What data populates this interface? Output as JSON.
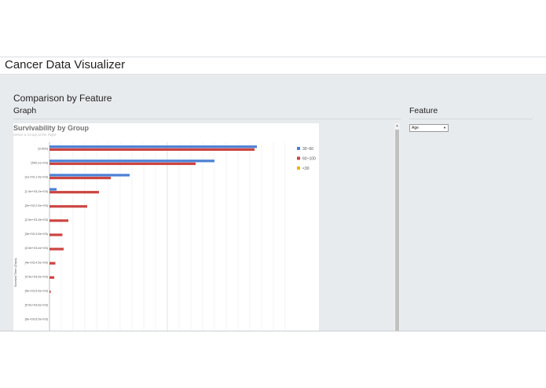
{
  "app": {
    "title": "Cancer Data Visualizer"
  },
  "page": {
    "section_title": "Comparison by Feature",
    "graph_title": "Graph",
    "feature_title": "Feature"
  },
  "feature_select": {
    "value": "Age"
  },
  "chart": {
    "title": "Survivability by Group",
    "subtitle": "Select a Group at the Right"
  },
  "colors": {
    "series1": "#4a7fd4",
    "series2": "#cc4440",
    "series3": "#f2b400"
  },
  "chart_data": {
    "type": "bar",
    "orientation": "horizontal",
    "title": "Survivability by Group",
    "subtitle": "Select a Group at the Right",
    "ylabel": "Survival Time (Days)",
    "xlabel": "",
    "legend_position": "right",
    "categories": [
      "[0,500)",
      "[500,1e+03)",
      "[1e+03,1.5e+03)",
      "[1.5e+03,2e+03)",
      "[2e+03,2.5e+03)",
      "[2.5e+03,3e+03)",
      "[3e+03,3.5e+03)",
      "[3.5e+03,4e+03)",
      "[4e+03,4.5e+03)",
      "[4.5e+03,5e+03)",
      "[5e+03,5.5e+03)",
      "[5.5e+03,6e+03)",
      "[6e+03,6.5e+03)"
    ],
    "series": [
      {
        "name": "30~60",
        "color": "#4a7fd4",
        "values": [
          88,
          70,
          34,
          3,
          0,
          0,
          0,
          0,
          0,
          0,
          0,
          0,
          0
        ]
      },
      {
        "name": "60~100",
        "color": "#cc4440",
        "values": [
          87,
          62,
          26,
          21,
          16,
          8,
          5.5,
          6,
          2.5,
          2,
          0.5,
          0,
          0
        ]
      },
      {
        "name": "<30",
        "color": "#f2b400",
        "values": [
          0,
          0,
          0,
          0,
          0,
          0,
          0,
          0,
          0,
          0,
          0,
          0,
          0
        ]
      }
    ],
    "xlim": [
      0,
      100
    ],
    "grid": true
  }
}
